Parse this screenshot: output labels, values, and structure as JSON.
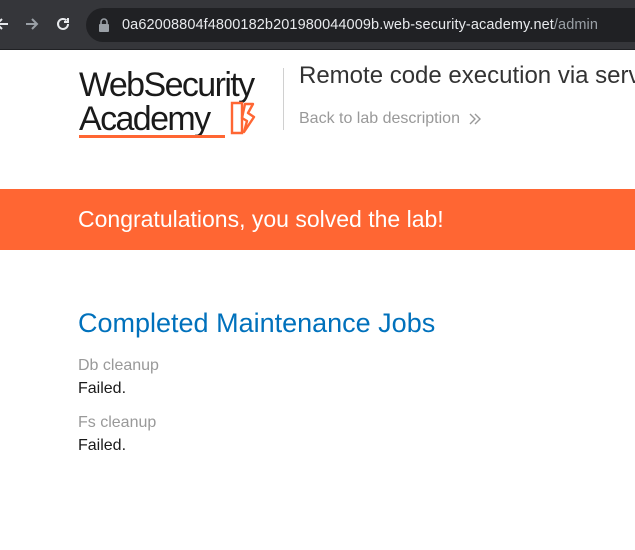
{
  "browser": {
    "url_host": "0a62008804f4800182b201980044009b.web-security-academy.net",
    "url_path": "/admin"
  },
  "header": {
    "logo_line1": "WebSecurity",
    "logo_line2": "Academy",
    "lab_title": "Remote code execution via serv",
    "back_link": "Back to lab description"
  },
  "banner": {
    "message": "Congratulations, you solved the lab!"
  },
  "main": {
    "title": "Completed Maintenance Jobs",
    "jobs": [
      {
        "name": "Db cleanup",
        "status": "Failed."
      },
      {
        "name": "Fs cleanup",
        "status": "Failed."
      }
    ]
  },
  "colors": {
    "accent": "#ff6633",
    "link_blue": "#0071bc",
    "chrome_bg": "#35363a"
  }
}
